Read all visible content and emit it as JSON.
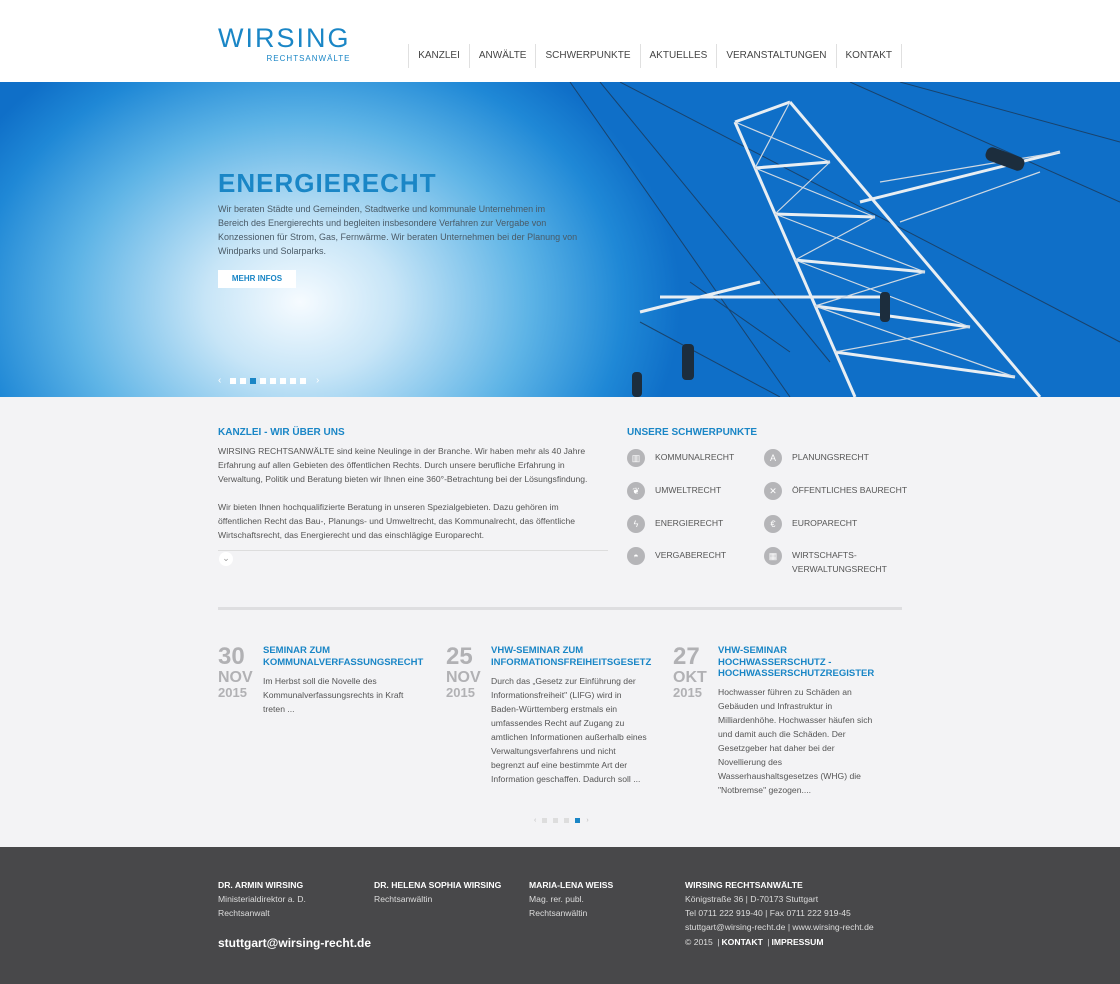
{
  "header": {
    "logo_main": "WIRSING",
    "logo_sub": "RECHTSANWÄLTE",
    "nav": [
      "KANZLEI",
      "ANWÄLTE",
      "SCHWERPUNKTE",
      "AKTUELLES",
      "VERANSTALTUNGEN",
      "KONTAKT"
    ]
  },
  "hero": {
    "title": "ENERGIERECHT",
    "text": "Wir beraten Städte und Gemeinden, Stadtwerke und kommunale Unternehmen im Bereich des Energierechts und begleiten insbesondere Verfahren zur Vergabe von Konzessionen für Strom, Gas, Fernwärme. Wir beraten Unternehmen bei der Planung von Windparks und Solarparks.",
    "button": "MEHR INFOS",
    "prev": "‹",
    "next": "›",
    "slide_count": 8,
    "active_slide": 3
  },
  "about": {
    "title": "KANZLEI - WIR ÜBER UNS",
    "p1": "WIRSING RECHTSANWÄLTE sind keine Neulinge in der Branche. Wir haben mehr als 40 Jahre Erfahrung auf allen Gebieten des öffentlichen Rechts. Durch unsere berufliche Erfahrung in Verwaltung, Politik und Beratung bieten wir Ihnen eine 360°-Betrachtung bei der Lösungsfindung.",
    "p2": "Wir bieten Ihnen hochqualifizierte Beratung in unseren Spezialgebieten. Dazu gehören im öffentlichen Recht das Bau-, Planungs- und Umweltrecht, das Kommunalrecht, das öffentliche Wirtschaftsrecht, das Energierecht und das einschlägige Europarecht.",
    "more_icon": "chevron-down-icon"
  },
  "focus": {
    "title": "UNSERE SCHWERPUNKTE",
    "items": [
      {
        "label": "KOMMUNALRECHT",
        "icon": "building-icon",
        "glyph": "▥"
      },
      {
        "label": "PLANUNGSRECHT",
        "icon": "compass-icon",
        "glyph": "A"
      },
      {
        "label": "UMWELTRECHT",
        "icon": "leaf-icon",
        "glyph": "❦"
      },
      {
        "label": "ÖFFENTLICHES BAURECHT",
        "icon": "tools-icon",
        "glyph": "✕"
      },
      {
        "label": "ENERGIERECHT",
        "icon": "energy-icon",
        "glyph": "ϟ"
      },
      {
        "label": "EUROPARECHT",
        "icon": "euro-icon",
        "glyph": "€"
      },
      {
        "label": "VERGABERECHT",
        "icon": "car-icon",
        "glyph": "◓"
      },
      {
        "label": "WIRTSCHAFTS-\nVERWALTUNGSRECHT",
        "icon": "factory-icon",
        "glyph": "▦"
      }
    ]
  },
  "events": [
    {
      "day": "30",
      "month": "NOV",
      "year": "2015",
      "title": "SEMINAR ZUM KOMMUNALVERFASSUNGSRECHT",
      "body": "Im Herbst soll die Novelle des Kommunalverfassungsrechts in Kraft treten ..."
    },
    {
      "day": "25",
      "month": "NOV",
      "year": "2015",
      "title": "VHW-SEMINAR ZUM INFORMATIONSFREIHEITSGESETZ",
      "body": "Durch das „Gesetz zur Einführung der Informationsfreiheit\" (LIFG) wird in Baden-Württemberg erstmals ein umfassendes Recht auf Zugang zu amtlichen Informationen außerhalb eines Verwaltungsverfahrens und nicht begrenzt auf eine bestimmte Art der Information geschaffen. Dadurch soll ..."
    },
    {
      "day": "27",
      "month": "OKT",
      "year": "2015",
      "title": "VHW-SEMINAR HOCHWASSERSCHUTZ - HOCHWASSERSCHUTZREGISTER",
      "body": "Hochwasser führen zu Schäden an Gebäuden und Infrastruktur in Milliardenhöhe. Hochwasser häufen sich und damit auch die Schäden. Der Gesetzgeber hat daher bei der Novellierung des Wasserhaushaltsgesetzes (WHG) die \"Notbremse\" gezogen...."
    }
  ],
  "pager": {
    "prev": "‹",
    "next": "›",
    "count": 4,
    "active": 4
  },
  "footer": {
    "people": [
      {
        "name": "DR. ARMIN WIRSING",
        "lines": [
          "Ministerialdirektor a. D.",
          "Rechtsanwalt"
        ]
      },
      {
        "name": "DR. HELENA SOPHIA WIRSING",
        "lines": [
          "Rechtsanwältin"
        ]
      },
      {
        "name": "MARIA-LENA WEISS",
        "lines": [
          "Mag. rer. publ.",
          "Rechtsanwältin"
        ]
      }
    ],
    "company": {
      "name": "WIRSING RECHTSANWÄLTE",
      "lines": [
        "Königstraße 36 | D-70173 Stuttgart",
        "Tel 0711 222 919-40 | Fax 0711 222 919-45",
        "stuttgart@wirsing-recht.de | www.wirsing-recht.de"
      ]
    },
    "email": "stuttgart@wirsing-recht.de",
    "copyright": "© 2015",
    "sep": "|",
    "link_contact": "KONTAKT",
    "link_imprint": "IMPRESSUM"
  }
}
